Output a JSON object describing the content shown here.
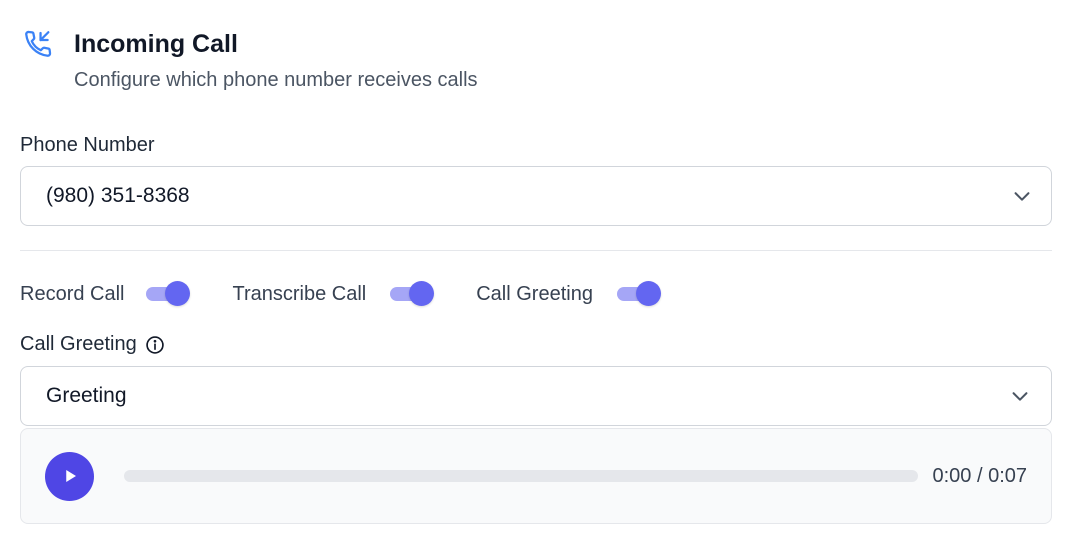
{
  "header": {
    "icon": "phone-incoming-icon",
    "title": "Incoming Call",
    "subtitle": "Configure which phone number receives calls"
  },
  "phone_number": {
    "label": "Phone Number",
    "value": "(980) 351-8368"
  },
  "toggles": [
    {
      "label": "Record Call",
      "on": true
    },
    {
      "label": "Transcribe Call",
      "on": true
    },
    {
      "label": "Call Greeting",
      "on": true
    }
  ],
  "greeting": {
    "label": "Call Greeting",
    "info_icon": "info-icon",
    "value": "Greeting"
  },
  "player": {
    "time": "0:00 / 0:07",
    "progress_fraction": 0
  },
  "colors": {
    "accent": "#6366f1",
    "accent_light": "#a5a6f6",
    "play_button": "#4f46e5",
    "icon_blue": "#3b82f6"
  }
}
